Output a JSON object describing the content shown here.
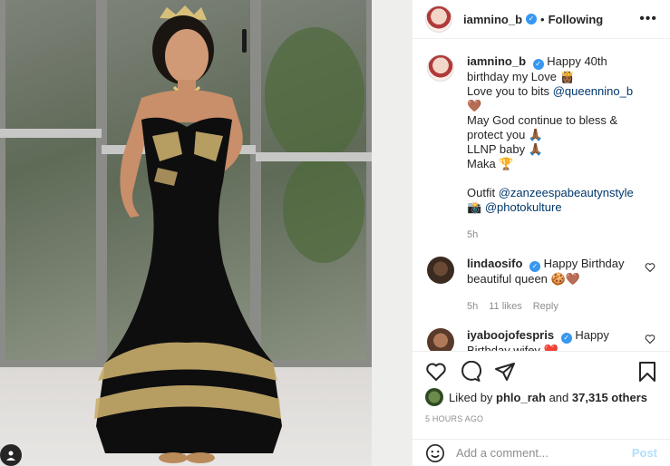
{
  "post_author": {
    "username": "iamnino_b",
    "separator": "•",
    "follow_state": "Following",
    "more_icon": "more-horizontal-icon"
  },
  "caption": {
    "username": "iamnino_b",
    "lines": [
      "Happy 40th birthday my Love 👸🏾",
      "Love you to bits",
      "May God continue to bless & protect you 🙏🏾",
      "LLNP baby 🙏🏾",
      "Maka 🏆"
    ],
    "mention_1": "@queennino_b",
    "mention_1_suffix": " 🤎",
    "outfit_label": "Outfit",
    "outfit_mention": "@zanzeespabeautynstyle",
    "camera_emoji": "📸",
    "photo_mention": "@photokulture",
    "time": "5h"
  },
  "comments": [
    {
      "username": "lindaosifo",
      "text": "Happy Birthday beautiful queen 🍪🤎",
      "time": "5h",
      "likes": "11 likes",
      "reply": "Reply"
    },
    {
      "username": "iyaboojofespris",
      "text": "Happy Birthday wifey ❤️"
    }
  ],
  "likes": {
    "prefix": "Liked by",
    "user": "phlo_rah",
    "joiner": "and",
    "count": "37,315 others"
  },
  "post_date": "5 HOURS AGO",
  "comment_box": {
    "placeholder": "Add a comment...",
    "post_label": "Post"
  },
  "colors": {
    "link": "#00376b",
    "verified": "#3897f0",
    "muted": "#8e8e8e",
    "post_disabled": "#b2dffc"
  }
}
